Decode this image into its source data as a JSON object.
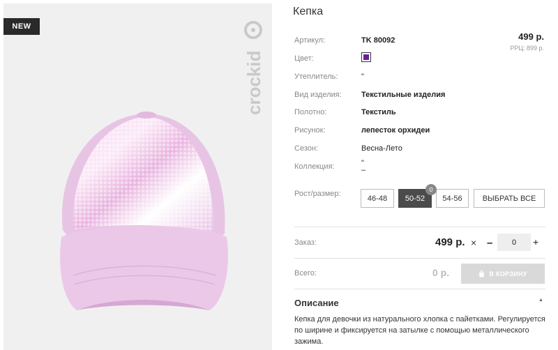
{
  "product": {
    "badge": "NEW",
    "brand_logo_text": "crockid",
    "title": "Кепка",
    "price": "499 р.",
    "rrp": "РРЦ: 899 р."
  },
  "attributes": [
    {
      "label": "Артикул:",
      "value": "TK 80092"
    },
    {
      "label": "Цвет:",
      "value": ""
    },
    {
      "label": "Утеплитель:",
      "value": "\""
    },
    {
      "label": "Вид изделия:",
      "value": "Текстильные изделия"
    },
    {
      "label": "Полотно:",
      "value": "Текстиль"
    },
    {
      "label": "Рисунок:",
      "value": "лепесток орхидеи"
    },
    {
      "label": "Сезон:",
      "value": "Весна-Лето"
    },
    {
      "label": "Коллекция:",
      "value": "\" –"
    }
  ],
  "color_swatch": "#6a1f9a",
  "sizes": {
    "label": "Рост/размер:",
    "options": [
      "46-48",
      "50-52",
      "54-56"
    ],
    "selected": "50-52",
    "selected_count": "0",
    "select_all": "ВЫБРАТЬ ВСЕ"
  },
  "order": {
    "label": "Заказ:",
    "price": "499 р.",
    "times": "×",
    "minus": "–",
    "quantity": "0",
    "plus": "+"
  },
  "total": {
    "label": "Всего:",
    "value": "0 р.",
    "cart_button": "В КОРЗИНУ"
  },
  "description": {
    "title": "Описание",
    "text": "Кепка для девочки из натурального хлопка с пайетками. Регулируется по ширине и фиксируется на затылке с помощью металлического зажима."
  },
  "icons": [
    "bag-icon",
    "collapse-arrow-icon",
    "cap-photo",
    "brand-logo"
  ]
}
